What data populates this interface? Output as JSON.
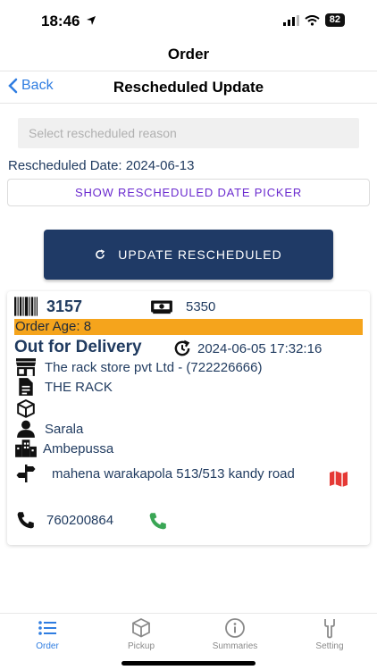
{
  "status_bar": {
    "time": "18:46",
    "battery": "82"
  },
  "nav": {
    "title": "Order"
  },
  "sub_header": {
    "back_label": "Back",
    "title": "Rescheduled Update"
  },
  "form": {
    "reason_placeholder": "Select rescheduled reason",
    "date_label": "Rescheduled Date: 2024-06-13",
    "picker_button_label": "SHOW RESCHEDULED DATE PICKER",
    "update_button_label": "UPDATE RESCHEDULED"
  },
  "order": {
    "id": "3157",
    "amount": "5350",
    "age": "Order Age: 8",
    "status": "Out for Delivery",
    "status_time": "2024-06-05 17:32:16",
    "store": "The rack store pvt Ltd - (722226666)",
    "brand": "THE RACK",
    "package": "",
    "customer": "Sarala",
    "city": "Ambepussa",
    "address": "mahena warakapola 513/513 kandy road",
    "phone": "760200864",
    "colors": {
      "age_bar": "#f5a41c",
      "map": "#e53935",
      "call": "#3aa655"
    }
  },
  "tabs": [
    {
      "label": "Order",
      "icon": "list-icon",
      "active": true
    },
    {
      "label": "Pickup",
      "icon": "box-icon",
      "active": false
    },
    {
      "label": "Summaries",
      "icon": "info-icon",
      "active": false
    },
    {
      "label": "Setting",
      "icon": "wrench-icon",
      "active": false
    }
  ]
}
